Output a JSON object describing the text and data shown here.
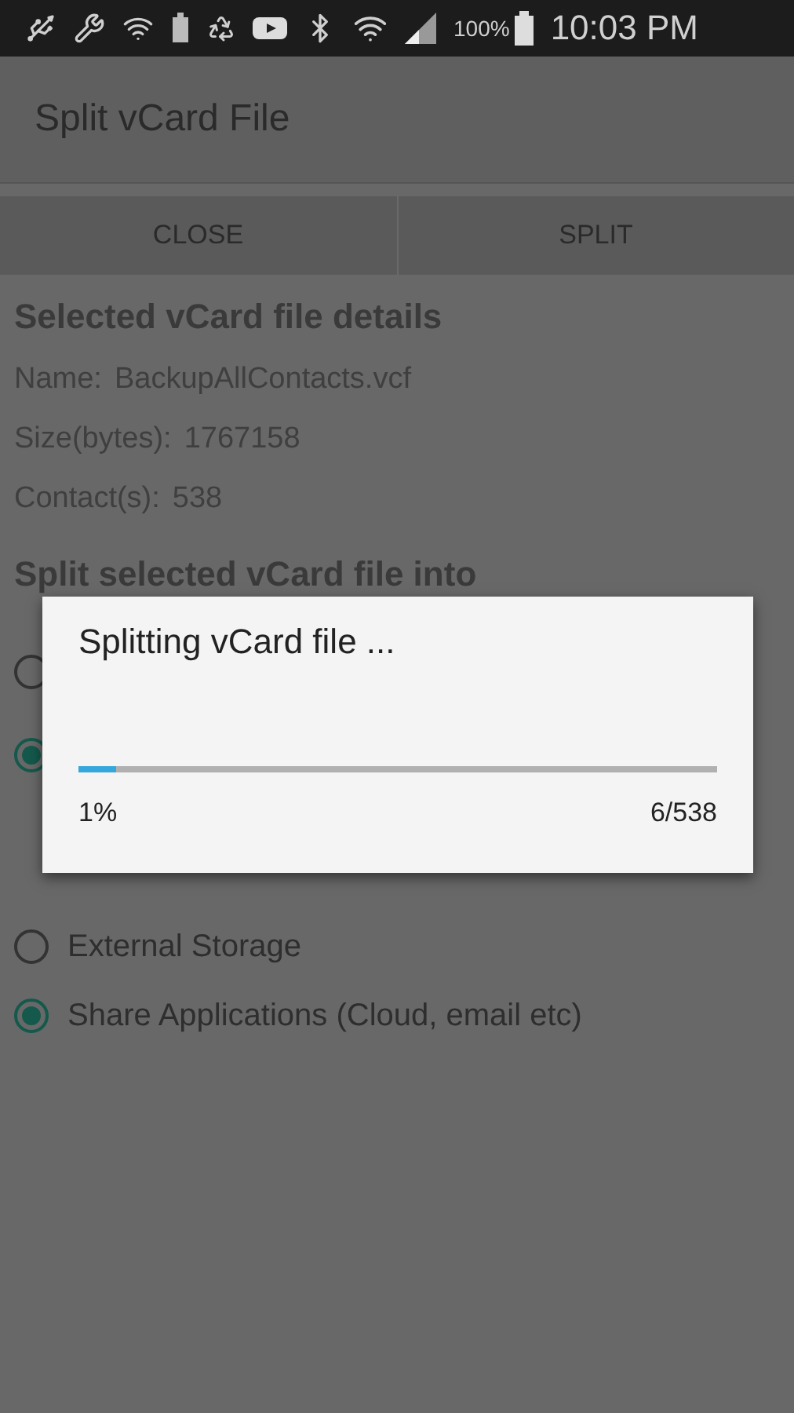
{
  "status_bar": {
    "battery_percent": "100%",
    "time": "10:03 PM"
  },
  "app_bar": {
    "title": "Split vCard File"
  },
  "actions": [
    {
      "label": "CLOSE"
    },
    {
      "label": "SPLIT"
    }
  ],
  "details": {
    "heading": "Selected vCard file details",
    "lines": [
      {
        "label": "Name:",
        "value": "BackupAllContacts.vcf"
      },
      {
        "label": "Size(bytes):",
        "value": "1767158"
      },
      {
        "label": "Contact(s):",
        "value": "538"
      }
    ]
  },
  "split_section": {
    "heading": "Split selected vCard file into",
    "options": [
      {
        "selected": false
      },
      {
        "selected": true
      }
    ]
  },
  "save_section": {
    "options": [
      {
        "label": "External Storage",
        "selected": false
      },
      {
        "label": "Share Applications (Cloud, email etc)",
        "selected": true
      }
    ]
  },
  "dialog": {
    "title": "Splitting vCard file ...",
    "level": 0.06,
    "percent": "1%",
    "count": "6/538"
  }
}
